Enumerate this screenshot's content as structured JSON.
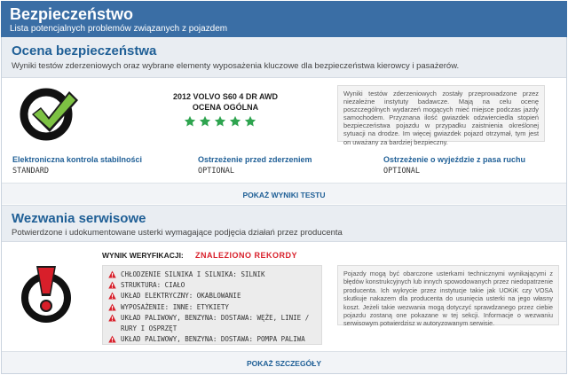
{
  "header": {
    "title": "Bezpieczeństwo",
    "subtitle": "Lista potencjalnych problemów związanych z pojazdem"
  },
  "safety": {
    "title": "Ocena bezpieczeństwa",
    "description": "Wyniki testów zderzeniowych oraz wybrane elementy wyposażenia kluczowe dla bezpieczeństwa kierowcy i pasażerów.",
    "icon": "checkmark-icon",
    "vehicle": "2012 VOLVO S60 4 DR AWD",
    "overall_label": "OCENA OGÓLNA",
    "stars": 5,
    "star_color": "#2ea44f",
    "info_text": "Wyniki testów zderzeniowych zostały przeprowadzone przez niezależne instytuty badawcze. Mają na celu ocenę poszczególnych wydarzeń mogących mieć miejsce podczas jazdy samochodem. Przyznana ilość gwiazdek odzwierciedla stopień bezpieczeństwa pojazdu w przypadku zaistnienia określonej sytuacji na drodze. Im więcej gwiazdek pojazd otrzymał, tym jest on uważany za bardziej bezpieczny.",
    "features": [
      {
        "label": "Elektroniczna kontrola stabilności",
        "value": "STANDARD"
      },
      {
        "label": "Ostrzeżenie przed zderzeniem",
        "value": "OPTIONAL"
      },
      {
        "label": "Ostrzeżenie o wyjeździe z pasa ruchu",
        "value": "OPTIONAL"
      }
    ],
    "link": "POKAŻ WYNIKI TESTU"
  },
  "recalls": {
    "title": "Wezwania serwisowe",
    "description": "Potwierdzone i udokumentowane usterki wymagające podjęcia działań przez producenta",
    "icon": "exclamation-icon",
    "verification_label": "WYNIK WERYFIKACJI:",
    "verification_value": "ZNALEZIONO REKORDY",
    "items": [
      "CHŁODZENIE SILNIKA I SILNIKA: SILNIK",
      "STRUKTURA: CIAŁO",
      "UKŁAD ELEKTRYCZNY: OKABLOWANIE",
      "WYPOSAŻENIE: INNE: ETYKIETY",
      "UKŁAD PALIWOWY, BENZYNA: DOSTAWA: WĘŻE, LINIE / RURY I OSPRZĘT",
      "UKŁAD PALIWOWY, BENZYNA: DOSTAWA: POMPA PALIWA"
    ],
    "info_text": "Pojazdy mogą być obarczone usterkami technicznymi wynikającymi z błędów konstrukcyjnych lub innych spowodowanych przez niedopatrzenie producenta. Ich wykrycie przez instytucje takie jak UOKiK czy VOSA skutkuje nakazem dla producenta do usunięcia usterki na jego własny koszt. Jeżeli takie wezwania mogą dotyczyć sprawdzanego przez ciebie pojazdu zostaną one pokazane w tej sekcji. Informacje o wezwaniu serwisowym potwierdzisz w autoryzowanym serwisie.",
    "link": "POKAŻ SZCZEGÓŁY"
  },
  "colors": {
    "header": "#3a6ea5",
    "accent": "#1f5f96",
    "check_green": "#7dc243",
    "alert_red": "#d81f2a"
  }
}
